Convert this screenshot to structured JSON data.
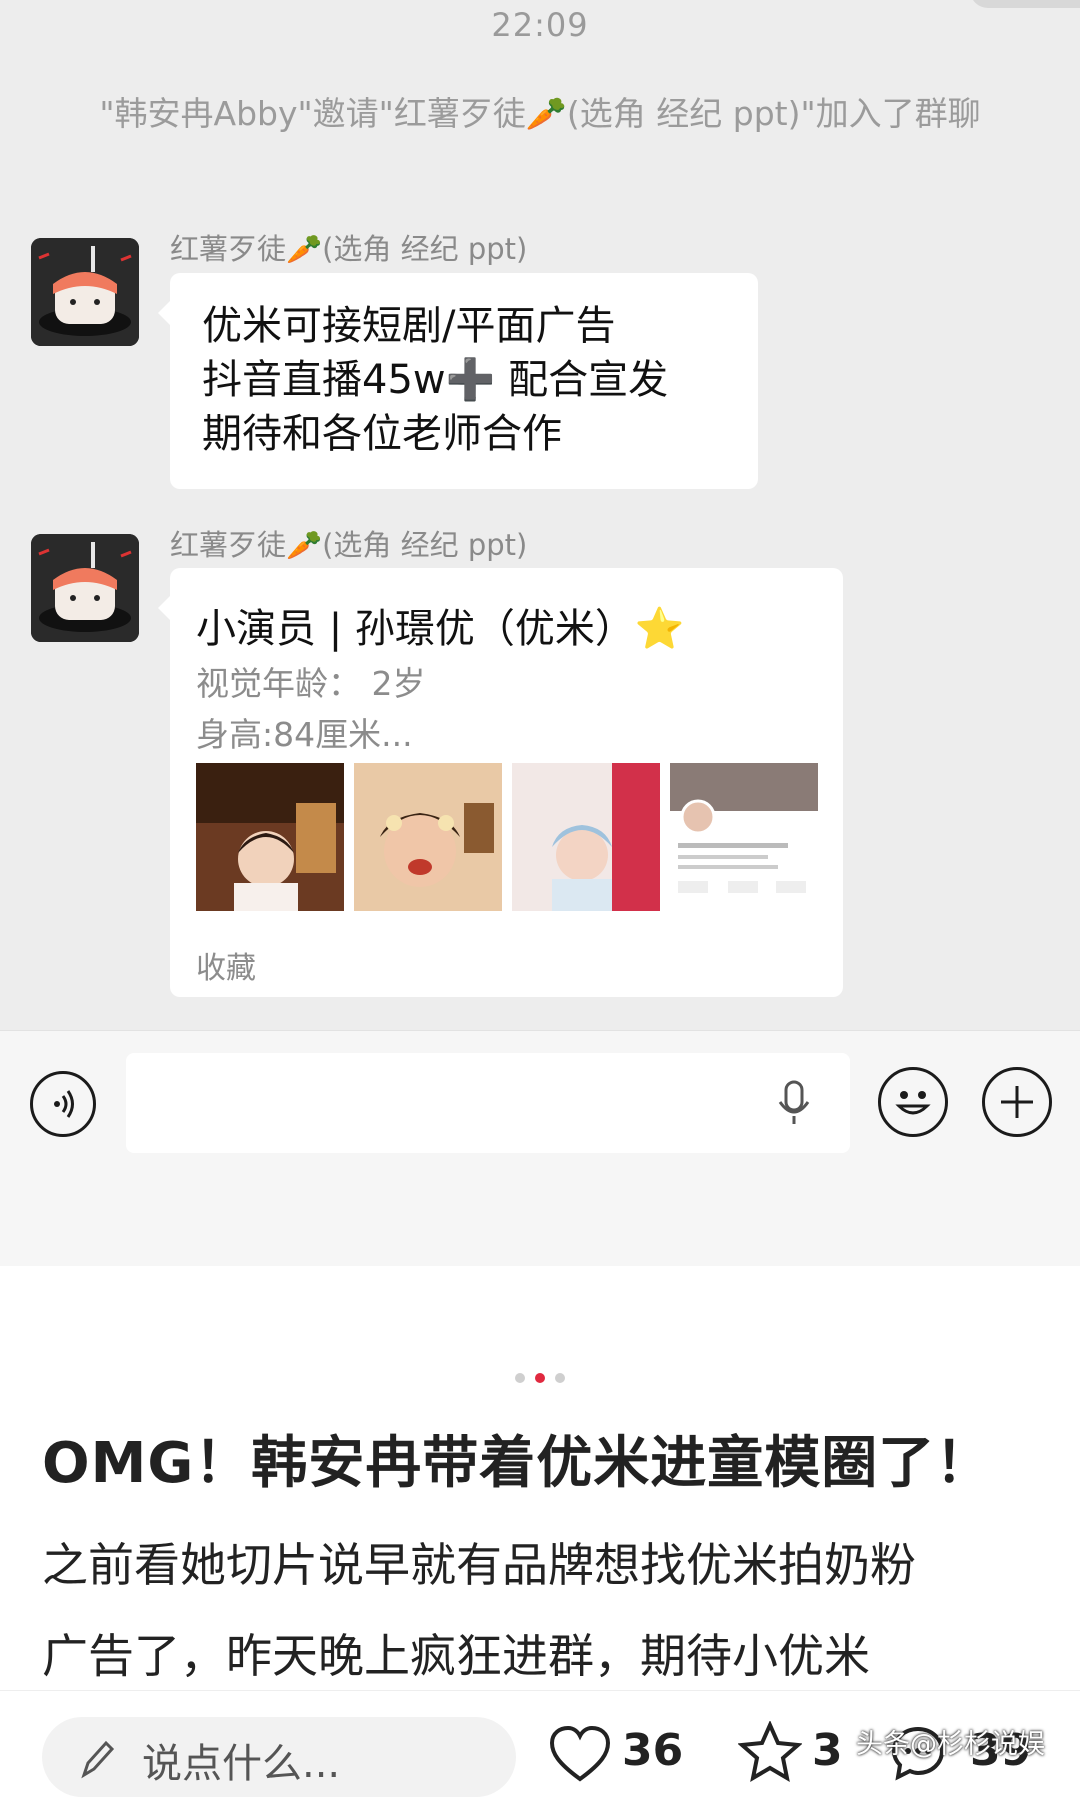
{
  "chat": {
    "time": "22:09",
    "system_message": "\"韩安冉Abby\"邀请\"红薯歹徒🥕(选角 经纪 ppt)\"加入了群聊",
    "messages": [
      {
        "sender": "红薯歹徒🥕(选角 经纪 ppt)",
        "type": "text",
        "lines": [
          "优米可接短剧/平面广告",
          "抖音直播45w➕ 配合宣发",
          "期待和各位老师合作"
        ]
      },
      {
        "sender": "红薯歹徒🥕(选角 经纪 ppt)",
        "type": "card",
        "title": "小演员 | 孙璟优（优米）⭐",
        "lines": [
          "视觉年龄： 2岁",
          "身高:84厘米..."
        ],
        "thumbnails": [
          "baby-photo-1",
          "baby-photo-2",
          "baby-photo-3",
          "profile-screenshot"
        ],
        "footer": "收藏"
      }
    ]
  },
  "input_bar": {
    "voice_icon": "voice-icon",
    "mic_icon": "microphone-icon",
    "emoji_icon": "emoji-icon",
    "plus_icon": "plus-icon"
  },
  "article": {
    "carousel": {
      "count": 3,
      "active": 2
    },
    "headline": "OMG！韩安冉带着优米进童模圈了！",
    "body_lines": [
      "之前看她切片说早就有品牌想找优米拍奶粉",
      "广告了，昨天晚上疯狂进群，期待小优米"
    ]
  },
  "bottom_bar": {
    "comment_placeholder": "说点什么...",
    "likes": "36",
    "favorites": "3",
    "comments": "39"
  },
  "watermark": "头条@杉杉说娱",
  "colors": {
    "chat_bg": "#ededed",
    "accent_dot": "#e0293f",
    "bubble": "#ffffff"
  }
}
